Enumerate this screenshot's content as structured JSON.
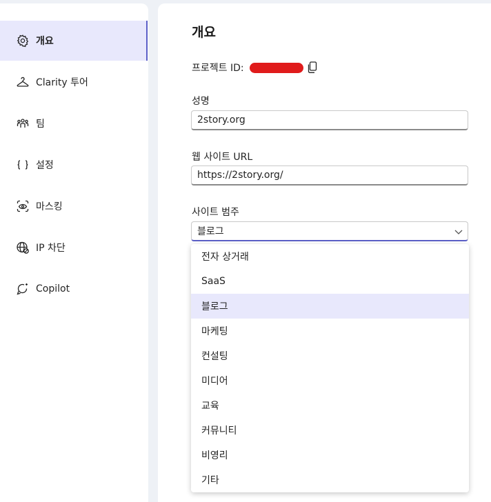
{
  "sidebar": {
    "items": [
      {
        "label": "개요",
        "icon": "gear-icon",
        "active": true
      },
      {
        "label": "Clarity 투어",
        "icon": "hanger-icon",
        "active": false
      },
      {
        "label": "팀",
        "icon": "people-team-icon",
        "active": false
      },
      {
        "label": "설정",
        "icon": "braces-icon",
        "active": false
      },
      {
        "label": "마스킹",
        "icon": "eye-mask-icon",
        "active": false
      },
      {
        "label": "IP 차단",
        "icon": "globe-block-icon",
        "active": false
      },
      {
        "label": "Copilot",
        "icon": "copilot-icon",
        "active": false
      }
    ]
  },
  "main": {
    "title": "개요",
    "project_id_label": "프로젝트 ID:",
    "name_label": "성명",
    "name_value": "2story.org",
    "url_label": "웹 사이트 URL",
    "url_value": "https://2story.org/",
    "category_label": "사이트 범주",
    "category_value": "블로그",
    "category_options": [
      "전자 상거래",
      "SaaS",
      "블로그",
      "마케팅",
      "컨설팅",
      "미디어",
      "교육",
      "커뮤니티",
      "비영리",
      "기타"
    ],
    "selected_option": "블로그"
  },
  "colors": {
    "accent": "#5b5fc7",
    "active_bg": "#e8e8fc",
    "redaction": "#e01b1b",
    "page_bg": "#eef1f6"
  }
}
